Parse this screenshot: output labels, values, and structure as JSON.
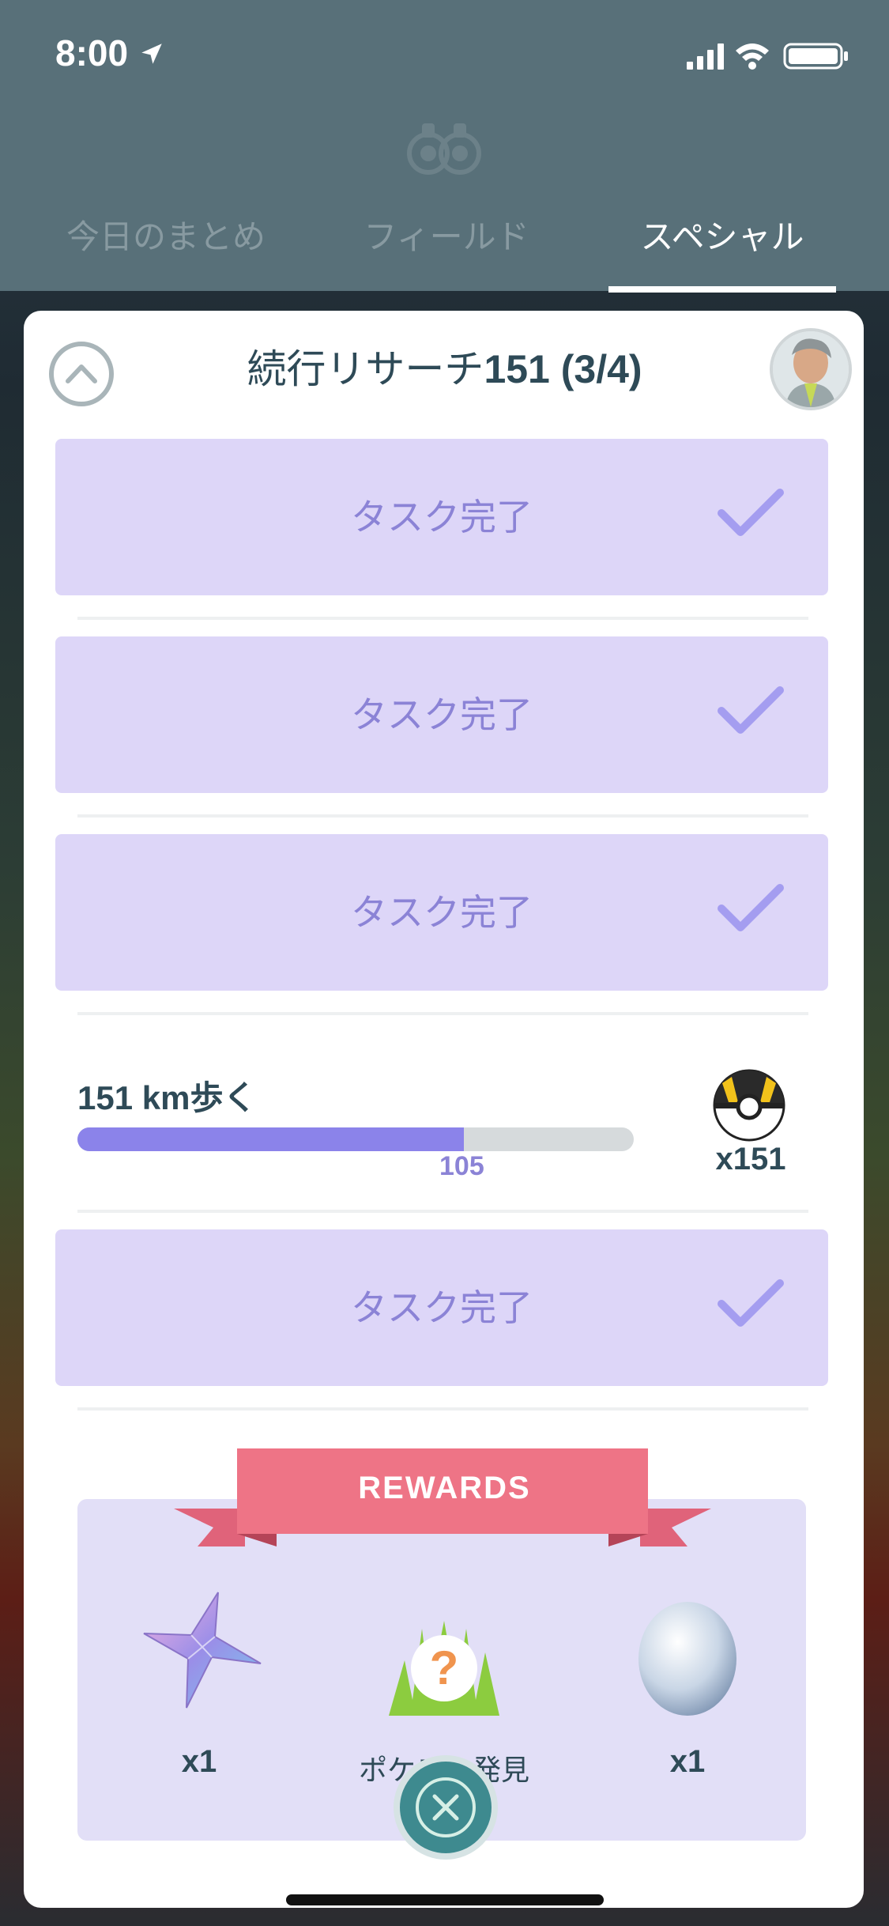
{
  "status_bar": {
    "time": "8:00"
  },
  "tabs": [
    {
      "label": "今日のまとめ",
      "active": false
    },
    {
      "label": "フィールド",
      "active": false
    },
    {
      "label": "スペシャル",
      "active": true
    }
  ],
  "research": {
    "title_prefix": "続行リサーチ",
    "title_suffix": "151 (3/4)"
  },
  "tasks_completed": [
    {
      "label": "タスク完了"
    },
    {
      "label": "タスク完了"
    },
    {
      "label": "タスク完了"
    }
  ],
  "active_task": {
    "label": "151 km歩く",
    "progress_value": "105",
    "progress_fraction": 0.695,
    "reward_qty": "x151",
    "reward_icon": "ultra-ball-icon"
  },
  "final_task": {
    "label": "タスク完了"
  },
  "rewards": {
    "heading": "REWARDS",
    "items": [
      {
        "icon": "stardust-shard-icon",
        "label": "x1"
      },
      {
        "icon": "pokemon-encounter-icon",
        "label": "ポケモン発見"
      },
      {
        "icon": "egg-icon",
        "label": "x1"
      }
    ]
  },
  "colors": {
    "header": "#587079",
    "task_done_bg": "#ddd6f8",
    "task_done_text": "#8b83d6",
    "progress_fill": "#8b83ea",
    "ribbon": "#e8707f",
    "close_button": "#3e8a8f"
  }
}
